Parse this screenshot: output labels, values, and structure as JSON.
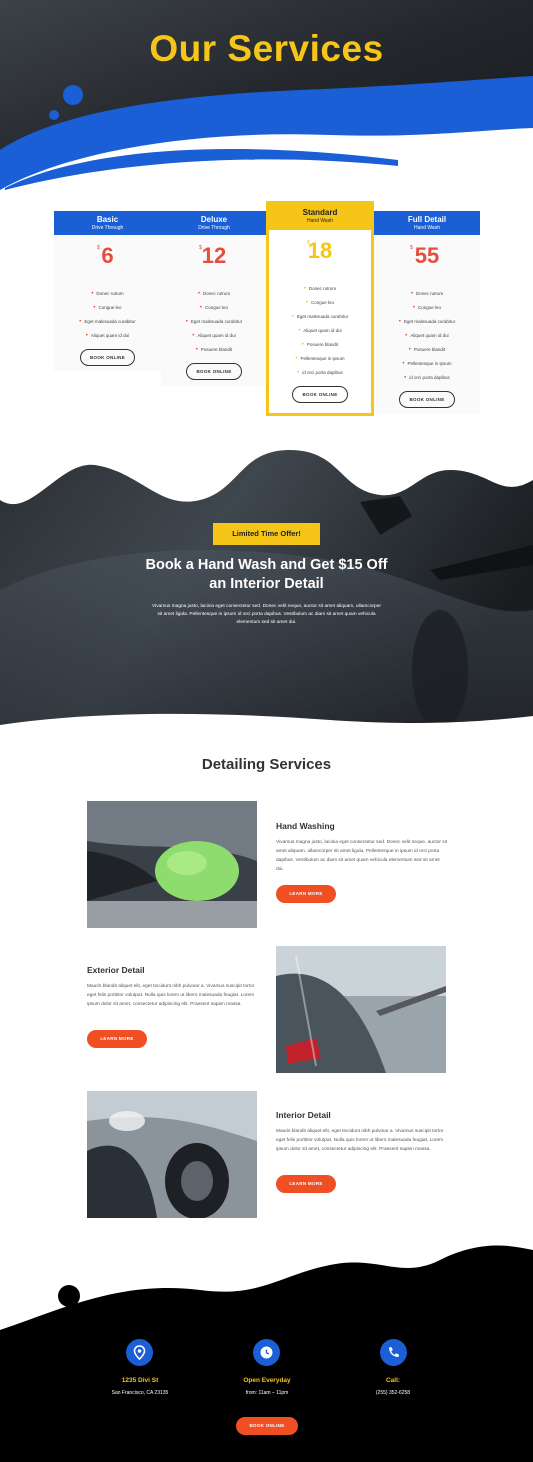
{
  "hero": {
    "title": "Our Services"
  },
  "plans": [
    {
      "name": "Basic",
      "sub": "Drive Through",
      "currency": "$",
      "price": "6",
      "features": [
        "Donec rutrum",
        "Congue leo",
        "Eget malesuada curabitur",
        "Aliquet quam id dui"
      ],
      "button": "BOOK ONLINE"
    },
    {
      "name": "Deluxe",
      "sub": "Drive Through",
      "currency": "$",
      "price": "12",
      "features": [
        "Donec rutrum",
        "Congue leo",
        "Eget malesuada curabitur",
        "Aliquet quam id dui",
        "Posuere blandit"
      ],
      "button": "BOOK ONLINE"
    },
    {
      "name": "Standard",
      "sub": "Hand Wash",
      "currency": "$",
      "price": "18",
      "features": [
        "Donec rutrum",
        "Congue leo",
        "Eget malesuada curabitur",
        "Aliquet quam id dui",
        "Posuere blandit",
        "Pellentesque in ipsum",
        "id orci porta dapibus"
      ],
      "button": "BOOK ONLINE"
    },
    {
      "name": "Full Detail",
      "sub": "Hand Wash",
      "currency": "$",
      "price": "55",
      "features": [
        "Donec rutrum",
        "Congue leo",
        "Eget malesuada curabitur",
        "Aliquet quam id dui",
        "Posuere blandit",
        "Pellentesque in ipsum",
        "id orci porta dapibus"
      ],
      "button": "BOOK ONLINE"
    }
  ],
  "offer": {
    "badge": "Limited Time Offer!",
    "title": "Book a Hand Wash and Get $15 Off an Interior Detail",
    "text": "Vivamus magna justo, lacinia eget consectetur sed. Donec velit neque, auctor sit amet aliquam, ullamcorper sit amet ligula. Pellentesque in ipsum id orci porta dapibus. Vestibulum ac diam sit amet quam vehicula elementum sed sit amet dui."
  },
  "detailing": {
    "title": "Detailing Services",
    "services": [
      {
        "title": "Hand Washing",
        "text": "Vivamus magna justo, lacinia eget consectetur sed. Donec velit neque, auctor sit amet aliquam, ullamcorper sit amet ligula. Pellentesque in ipsum id orci porta dapibus. Vestibulum ac diam sit amet quam vehicula elementum sed sit amet dui.",
        "button": "LEARN MORE"
      },
      {
        "title": "Exterior Detail",
        "text": "Mauris blandit aliquet elit, eget tincidunt nibh pulvinar a. Vivamus suscipit tortor eget felis porttitor volutpat. Nulla quis lorem ut libero malesuada feugiat. Lorem ipsum dolor sit amet, consectetur adipiscing elit. Praesent sapien massa.",
        "button": "LEARN MORE"
      },
      {
        "title": "Interior Detail",
        "text": "Mauris blandit aliquet elit, eget tincidunt nibh pulvinar a. Vivamus suscipit tortor eget felis porttitor volutpat. Nulla quis lorem ut libero malesuada feugiat. Lorem ipsum dolor sit amet, consectetur adipiscing elit. Praesent sapien massa.",
        "button": "LEARN MORE"
      }
    ]
  },
  "footer": {
    "items": [
      {
        "icon": "location-pin-icon",
        "title": "1235 Divi St",
        "sub": "San Francisco, CA 23135"
      },
      {
        "icon": "clock-icon",
        "title": "Open Everyday",
        "sub": "from: 11am – 11pm"
      },
      {
        "icon": "phone-icon",
        "title": "Call:",
        "sub": "(255) 352-6258"
      }
    ],
    "button": "BOOK ONLINE"
  },
  "colors": {
    "accent_yellow": "#f5c518",
    "brand_blue": "#1a5fd6",
    "cta_orange": "#f04e23",
    "price_red": "#e74c3c"
  }
}
